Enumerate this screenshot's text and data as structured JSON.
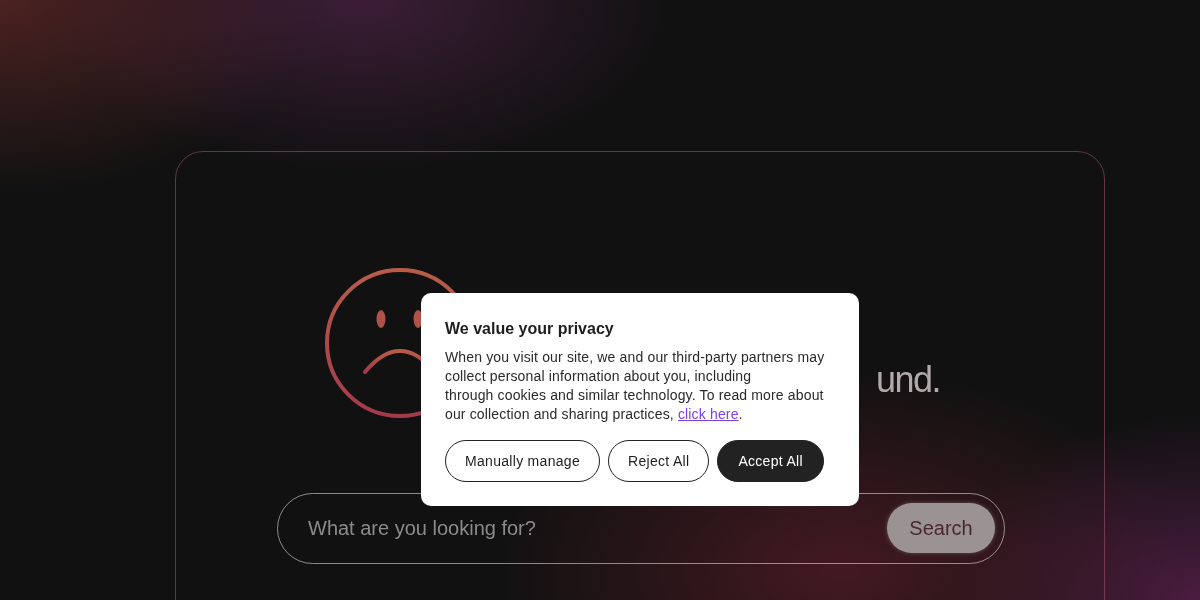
{
  "hero": {
    "heading": "und."
  },
  "search": {
    "placeholder": "What are you looking for?",
    "button": "Search"
  },
  "cookie_dialog": {
    "title": "We value your privacy",
    "body": "When you visit our site, we and our third-party partners may collect personal information about you, including\nthrough cookies and similar technology. To read more about our collection and sharing practices, ",
    "link": "click here",
    "body_end": ".",
    "buttons": [
      {
        "label": "Manually manage",
        "kind": "outline"
      },
      {
        "label": "Reject All",
        "kind": "outline"
      },
      {
        "label": "Accept All",
        "kind": "primary"
      }
    ]
  }
}
